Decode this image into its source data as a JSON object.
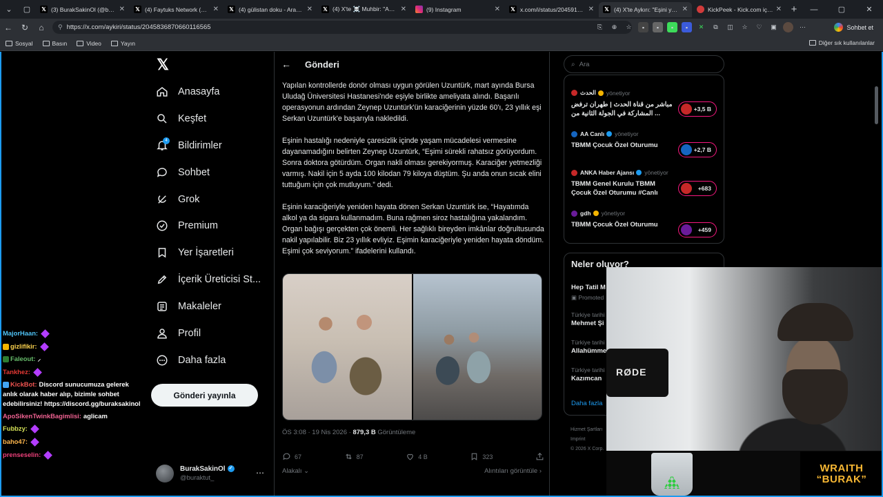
{
  "browser": {
    "tabs": [
      {
        "label": "(3) BurakSakinOl (@buraktut_)",
        "icon": "x"
      },
      {
        "label": "(4) Faytuks Network (@Faytuks)",
        "icon": "x"
      },
      {
        "label": "(4) gülistan doku - Arama / X",
        "icon": "x"
      },
      {
        "label": "(4) X'te ☠️ Muhbir: \"AKP'li",
        "icon": "x"
      },
      {
        "label": "(9) Instagram",
        "icon": "instagram"
      },
      {
        "label": "x.com/i/status/2045915071",
        "icon": "x"
      },
      {
        "label": "(4) X'te Aykırı: \"Eşini yaşatm",
        "icon": "x",
        "active": true
      },
      {
        "label": "KickPeek - Kick.com için Ge",
        "icon": "kick"
      }
    ],
    "url": "https://x.com/aykiri/status/2045836870660116565",
    "chat_button": "Sohbet et",
    "bookmarks": [
      "Sosyal",
      "Basın",
      "Video",
      "Yayın"
    ],
    "bookmarks_other": "Diğer sık kullanılanlar"
  },
  "x_nav": {
    "items": [
      "Anasayfa",
      "Keşfet",
      "Bildirimler",
      "Sohbet",
      "Grok",
      "Premium",
      "Yer İşaretleri",
      "İçerik Üreticisi St...",
      "Makaleler",
      "Profil",
      "Daha fazla"
    ],
    "notification_badge": "4",
    "post_button": "Gönderi yayınla",
    "profile_name": "BurakSakinOl",
    "profile_handle": "@buraktut_"
  },
  "post": {
    "header": "Gönderi",
    "paragraphs": [
      "Yapılan kontrollerde donör olması uygun görülen Uzuntürk, mart ayında Bursa Uludağ Üniversitesi Hastanesi'nde eşiyle birlikte ameliyata alındı. Başarılı operasyonun ardından Zeynep Uzuntürk'ün karaciğerinin yüzde 60'ı, 23 yıllık eşi Serkan Uzuntürk'e başarıyla nakledildi.",
      "Eşinin hastalığı nedeniyle çaresizlik içinde yaşam mücadelesi vermesine dayanamadığını belirten Zeynep Uzuntürk, “Eşimi sürekli rahatsız görüyordum. Sonra doktora götürdüm. Organ nakli olması gerekiyormuş. Karaciğer yetmezliği varmış. Nakil için 5 ayda 100 kilodan 79 kiloya düştüm. Şu anda onun sıcak elini tuttuğum için çok mutluyum.” dedi.",
      "Eşinin karaciğeriyle yeniden hayata dönen Serkan Uzuntürk ise, “Hayatımda alkol ya da sigara kullanmadım. Buna rağmen siroz hastalığına yakalandım. Organ bağışı gerçekten çok önemli. Her sağlıklı bireyden imkânlar doğrultusunda nakil yapılabilir. Biz 23 yıllık evliyiz. Eşimin karaciğeriyle yeniden hayata döndüm. Eşimi çok seviyorum.” ifadelerini kullandı."
    ],
    "time": "ÖS 3:08 · 19 Nis 2026 · ",
    "views": "879,3 B",
    "views_label": " Görüntüleme",
    "replies": "67",
    "reposts": "87",
    "likes": "4 B",
    "bookmarks": "323",
    "sort_label": "Alakalı",
    "quotes_label": "Alıntıları görüntüle"
  },
  "right": {
    "search_placeholder": "Ara",
    "live": [
      {
        "source": "الحدث",
        "role": "yönetiyor",
        "title": "مباشر من قناة الحدث | طهران ترفض المشاركة في الجولة الثانية من ...",
        "count": "+3,5 B"
      },
      {
        "source": "AA Canlı",
        "role": "yönetiyor",
        "title": "TBMM Çocuk Özel Oturumu",
        "count": "+2,7 B"
      },
      {
        "source": "ANKA Haber Ajansı",
        "role": "yönetiyor",
        "title": "TBMM Genel Kurulu TBMM Çocuk Özel Oturumu #Canlı",
        "count": "+683"
      },
      {
        "source": "gdh",
        "role": "yönetiyor",
        "title": "TBMM Çocuk Özel Oturumu",
        "count": "+459"
      }
    ],
    "trends_header": "Neler oluyor?",
    "trends": [
      {
        "category": "",
        "name": "Hep Tatil M",
        "sub": "Promoted"
      },
      {
        "category": "Türkiye tarihi",
        "name": "Mehmet Şi"
      },
      {
        "category": "Türkiye tarihi",
        "name": "Allahümme"
      },
      {
        "category": "Türkiye tarihi",
        "name": "Kazımcan"
      }
    ],
    "trends_more": "Daha fazla",
    "footer": [
      "Hizmet Şartları",
      "Imprint",
      "© 2026 X Corp."
    ]
  },
  "chat": [
    {
      "user": "MajorHaan:",
      "color": "#4fc3f7",
      "text": "",
      "emote": true
    },
    {
      "user": "gizlifikir:",
      "color": "#ffd54f",
      "text": "",
      "emote": true,
      "badge": "#f4b400"
    },
    {
      "user": "Faleout:",
      "color": "#66bb6a",
      "text": "",
      "emote": false,
      "badge": "#2e7d32",
      "extra": "⸝"
    },
    {
      "user": "Tankhez:",
      "color": "#e53935",
      "text": "",
      "emote": true
    },
    {
      "user": "KickBot:",
      "color": "#ef5350",
      "text": "Discord sunucumuza gelerek anlık olarak haber alıp, bizimle sohbet edebilirsiniz! https://discord.gg/buraksakinol",
      "emote": false,
      "badge": "#42a5f5"
    },
    {
      "user": "ApoSikenTwinkBagimlisi:",
      "color": "#f06292",
      "text": "aglicam",
      "emote": false
    },
    {
      "user": "Fubbzy:",
      "color": "#d4e157",
      "text": "",
      "emote": true
    },
    {
      "user": "baho47:",
      "color": "#ffb74d",
      "text": "",
      "emote": true
    },
    {
      "user": "prenseselin:",
      "color": "#ec407a",
      "text": "",
      "emote": true
    }
  ],
  "webcam": {
    "mic_brand": "RØDE",
    "overlay_line1": "WRAITH",
    "overlay_line2": "“BURAK”"
  },
  "colors": {
    "accent": "#1d9bf0",
    "live_ring": "#f91880",
    "background": "#000000"
  }
}
